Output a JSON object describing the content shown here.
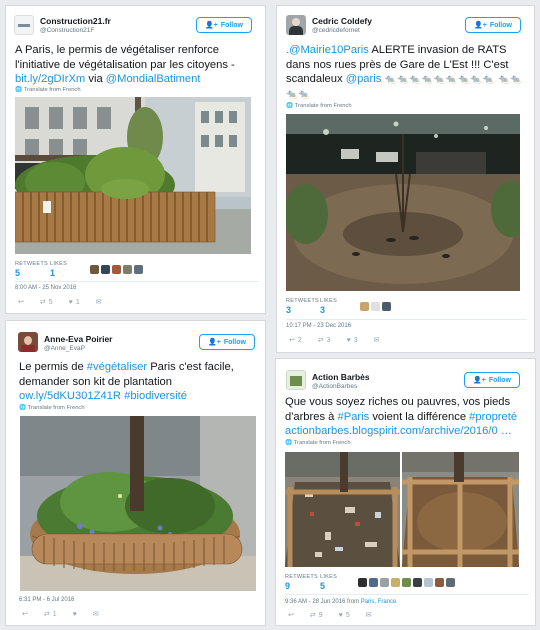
{
  "tweets": [
    {
      "name": "Construction21.fr",
      "handle": "@Construction21F",
      "follow": "Follow",
      "text_plain1": "A Paris, le permis de végétaliser renforce l'initiative de végétalisation par les citoyens - ",
      "link1": "bit.ly/2gDIrXm",
      "text_plain2": " via ",
      "link2": "@MondialBatiment",
      "translate": "Translate from French",
      "retweets_label": "RETWEETS",
      "retweets": "5",
      "likes_label": "LIKES",
      "likes": "1",
      "meta": "8:00 AM - 25 Nov 2016",
      "action_retweet": "5",
      "action_like": "1"
    },
    {
      "name": "Cedric Coldefy",
      "handle": "@cedricdefornet",
      "follow": "Follow",
      "link1": ".@Mairie10Paris",
      "text_plain1": " ALERTE invasion de RATS dans nos rues près de Gare de L'Est !!! C'est scandaleux ",
      "link2": "@paris",
      "rats": " 🐀🐀🐀🐀🐀🐀🐀🐀🐀 🐀🐀🐀🐀",
      "translate": "Translate from French",
      "retweets_label": "RETWEETS",
      "retweets": "3",
      "likes_label": "LIKES",
      "likes": "3",
      "meta": "10:17 PM - 23 Dec 2016",
      "action_reply": "2",
      "action_retweet": "3",
      "action_like": "3"
    },
    {
      "name": "Anne-Eva Poirier",
      "handle": "@Anne_EvaP",
      "follow": "Follow",
      "text_plain1": "Le permis de ",
      "link1": "#végétaliser",
      "text_plain2": " Paris c'est facile, demander son kit de plantation ",
      "link2": "ow.ly/5dKU301Z41R",
      "link3": "#biodiversité",
      "translate": "Translate from French",
      "meta": "6:31 PM - 6 Jul 2016",
      "action_retweet": "1"
    },
    {
      "name": "Action Barbès",
      "handle": "@ActionBarbes",
      "follow": "Follow",
      "text_plain1": "Que vous soyez riches ou pauvres, vos pieds d'arbres à ",
      "link1": "#Paris",
      "text_plain2": " voient la différence ",
      "link2": "#propreté",
      "link3": "actionbarbes.blogspirit.com/archive/2016/0 …",
      "translate": "Translate from French",
      "retweets_label": "RETWEETS",
      "retweets": "9",
      "likes_label": "LIKES",
      "likes": "5",
      "meta_prefix": "9:36 AM - 28 Jun 2016 from ",
      "meta_place": "Paris, France",
      "action_retweet": "9",
      "action_like": "5"
    }
  ],
  "colors": {
    "link": "#1b95e0",
    "background": "#e9ebee"
  },
  "icons": [
    "reply-icon",
    "retweet-icon",
    "heart-icon",
    "dm-icon",
    "add-user-icon",
    "globe-icon"
  ]
}
